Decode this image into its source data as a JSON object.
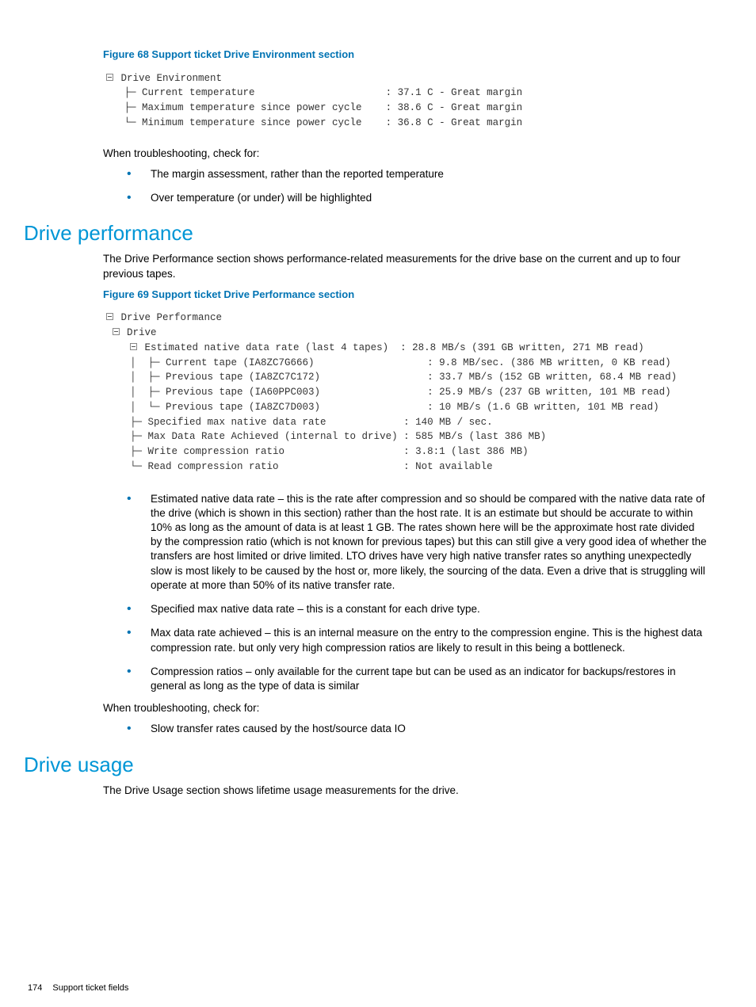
{
  "fig68": {
    "caption": "Figure 68 Support ticket Drive Environment section",
    "root": "Drive Environment",
    "rows": [
      {
        "label": "Current temperature",
        "value": "37.1 C - Great margin"
      },
      {
        "label": "Maximum temperature since power cycle",
        "value": "38.6 C - Great margin"
      },
      {
        "label": "Minimum temperature since power cycle",
        "value": "36.8 C - Great margin"
      }
    ]
  },
  "troubleshoot1": {
    "lead": "When troubleshooting, check for:",
    "items": [
      "The margin assessment, rather than the reported temperature",
      "Over temperature (or under) will be highlighted"
    ]
  },
  "section1": {
    "heading": "Drive performance",
    "intro": "The Drive Performance section shows performance-related measurements for the drive base on the current and up to four previous tapes."
  },
  "fig69": {
    "caption": "Figure 69 Support ticket Drive Performance section",
    "root": "Drive Performance",
    "sub": "Drive",
    "est": {
      "label": "Estimated native data rate (last 4 tapes)",
      "value": "28.8 MB/s (391 GB written, 271 MB read)"
    },
    "tapes": [
      {
        "label": "Current tape (IA8ZC7G666)",
        "value": "9.8 MB/sec. (386 MB written, 0 KB read)"
      },
      {
        "label": "Previous tape (IA8ZC7C172)",
        "value": "33.7 MB/s (152 GB written, 68.4 MB read)"
      },
      {
        "label": "Previous tape (IA60PPC003)",
        "value": "25.9 MB/s (237 GB written, 101 MB read)"
      },
      {
        "label": "Previous tape (IA8ZC7D003)",
        "value": "10 MB/s (1.6 GB written, 101 MB read)"
      }
    ],
    "extra": [
      {
        "label": "Specified max native data rate",
        "value": "140 MB / sec."
      },
      {
        "label": "Max Data Rate Achieved (internal to drive)",
        "value": "585 MB/s (last 386 MB)"
      },
      {
        "label": "Write compression ratio",
        "value": "3.8:1 (last 386 MB)"
      },
      {
        "label": "Read compression ratio",
        "value": "Not available"
      }
    ]
  },
  "bullets2": [
    "Estimated native data rate – this is the rate after compression and so should be compared with the native data rate of the drive (which is shown in this section) rather than the host rate. It is an estimate but should be accurate to within 10% as long as the amount of data is at least 1 GB. The rates shown here will be the approximate host rate divided by the compression ratio (which is not known for previous tapes) but this can still give a very good idea of whether the transfers are host limited or drive limited. LTO drives have very high native transfer rates so anything unexpectedly slow is most likely to be caused by the host or, more likely, the sourcing of the data. Even a drive that is struggling will operate at more than 50% of its native transfer rate.",
    "Specified max native data rate – this is a constant for each drive type.",
    "Max data rate achieved – this is an internal measure on the entry to the compression engine. This is the highest data compression rate. but only very high compression ratios are likely to result in this being a bottleneck.",
    "Compression ratios – only available for the current tape but can be used as an indicator for backups/restores in general as long as the type of data is similar"
  ],
  "troubleshoot2": {
    "lead": "When troubleshooting, check for:",
    "items": [
      "Slow transfer rates caused by the host/source data IO"
    ]
  },
  "section2": {
    "heading": "Drive usage",
    "intro": "The Drive Usage section shows lifetime usage measurements for the drive."
  },
  "footer": {
    "page": "174",
    "title": "Support ticket fields"
  }
}
